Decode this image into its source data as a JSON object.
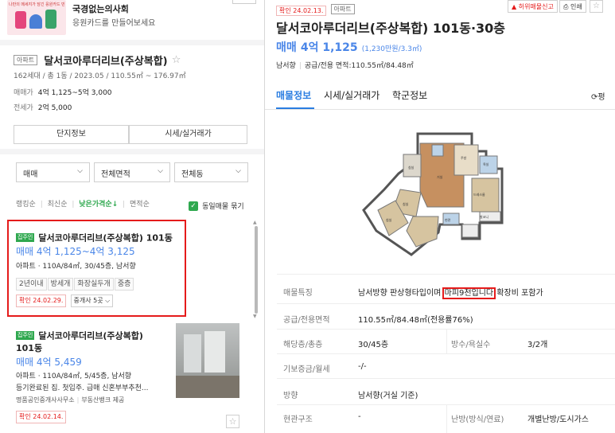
{
  "banner": {
    "title": "국경없는의사회",
    "subtitle": "응원카드를 만들어보세요",
    "image_text": "나만의 메세지가 담긴 응원카드 만들기 ▶"
  },
  "complex": {
    "type_tag": "아파트",
    "name": "달서코아루더리브(주상복합)",
    "info": "162세대 / 총 1동 / 2023.05 / 110.55㎡ ~ 176.97㎡",
    "sale_label": "매매가",
    "sale_value": "4억 1,125~5억 3,000",
    "jeonse_label": "전세가",
    "jeonse_value": "2억 5,000",
    "btn_info": "단지정보",
    "btn_price": "시세/실거래가"
  },
  "filters": {
    "trade": "매매",
    "area": "전체면적",
    "dong": "전체동"
  },
  "sort": {
    "items": [
      "랭킹순",
      "최신순",
      "낮은가격순↓",
      "면적순"
    ],
    "group_label": "동일매물 묶기"
  },
  "listing1": {
    "owner_tag": "집주인",
    "title": "달서코아루더리브(주상복합) 101동",
    "price": "매매 4억 1,125~4억 3,125",
    "spec": "아파트 · 110A/84㎡, 30/45층, 남서향",
    "chips": [
      "2년이내",
      "방세개",
      "화장실두개",
      "중층"
    ],
    "confirm": "확인 24.02.29.",
    "agents": "중개사 5곳"
  },
  "listing2": {
    "owner_tag": "집주인",
    "title_line1": "달서코아루더리브(주상복합)",
    "title_line2": "101동",
    "price": "매매 4억 5,459",
    "spec": "아파트 · 110A/84㎡, 5/45층, 남서향",
    "desc": "등기완료된 집. 첫입주. 급매 신혼부부추천...",
    "agency": "명품공인중개사사무소",
    "provider": "부동산뱅크 제공",
    "confirm": "확인 24.02.14."
  },
  "detail": {
    "confirm_tag": "확인 24.02.13.",
    "type_tag": "아파트",
    "report": "허위매물신고",
    "print": "인쇄",
    "title": "달서코아루더리브(주상복합) 101동·30층",
    "price_label": "매매",
    "price": "4억 1,125",
    "price_sub": "(1,230만원/3.3㎡)",
    "direction": "남서향",
    "area_info": "공급/전용 면적:110.55㎡/84.48㎡",
    "tabs": [
      "매물정보",
      "시세/실거래가",
      "학군정보"
    ],
    "side_tab": "평",
    "rows": [
      {
        "label": "매물특징",
        "value": "남서방향 판상형타입이며 마피9천입니다 확장비 포함가"
      },
      {
        "label": "공급/전용면적",
        "value": "110.55㎡/84.48㎡(전용률76%)"
      },
      {
        "label": "해당층/총층",
        "value": "30/45층",
        "label2": "방수/욕실수",
        "value2": "3/2개"
      },
      {
        "label": "기보증금/월세",
        "value": "-/-"
      },
      {
        "label": "방향",
        "value": "남서향(거실 기준)"
      },
      {
        "label": "현관구조",
        "value": "-",
        "label2": "난방(방식/연료)",
        "value2": "개별난방/도시가스"
      }
    ],
    "feature_pre": "남서방향 판상형타입이며 ",
    "feature_hl": "마피9천입니다",
    "feature_post": " 확장비 포함가"
  },
  "floorplan": {
    "rooms": [
      "침실",
      "침실",
      "침실",
      "거실",
      "주방",
      "발코니",
      "욕실",
      "드레스룸",
      "현관"
    ]
  },
  "colors": {
    "accent_blue": "#4a86e8",
    "confirm_red": "#e51b1b",
    "tab_active": "#2a7de1",
    "owner_green": "#2fa84f"
  }
}
